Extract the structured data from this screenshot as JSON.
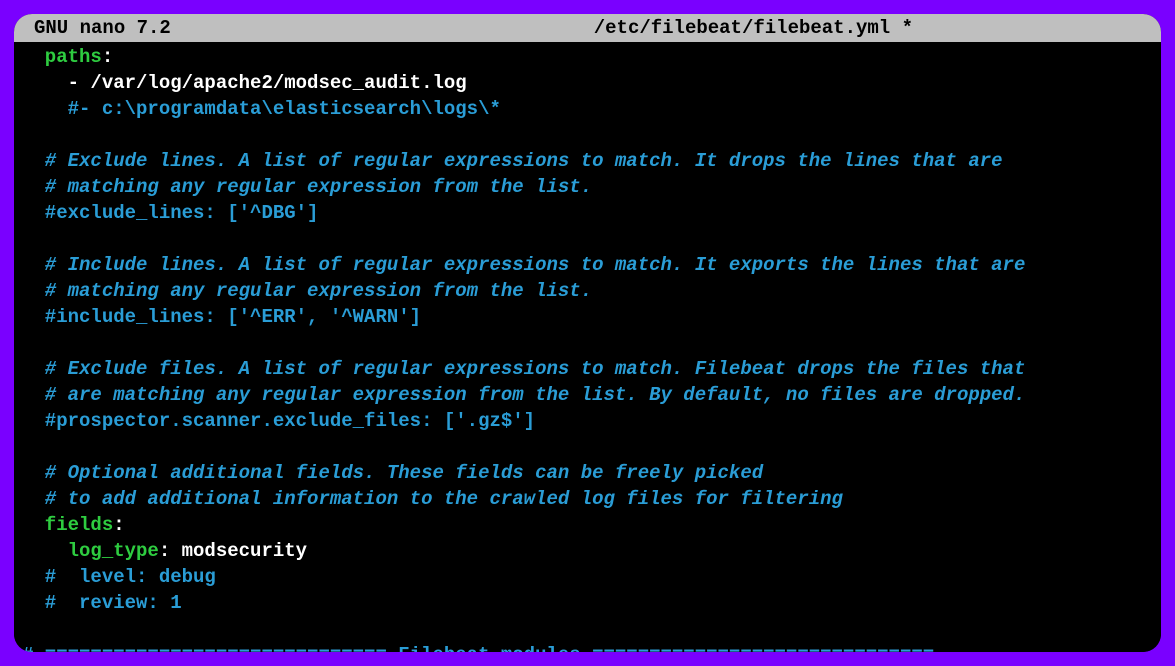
{
  "titlebar": {
    "app": "GNU nano 7.2",
    "file": "/etc/filebeat/filebeat.yml *"
  },
  "lines": {
    "l01a": "  paths",
    "l01b": ":",
    "l02": "    - /var/log/apache2/modsec_audit.log",
    "l03": "    #- c:\\programdata\\elasticsearch\\logs\\*",
    "l04": "",
    "l05": "  # Exclude lines. A list of regular expressions to match. It drops the lines that are",
    "l06": "  # matching any regular expression from the list.",
    "l07": "  #exclude_lines: ['^DBG']",
    "l08": "",
    "l09": "  # Include lines. A list of regular expressions to match. It exports the lines that are",
    "l10": "  # matching any regular expression from the list.",
    "l11": "  #include_lines: ['^ERR', '^WARN']",
    "l12": "",
    "l13": "  # Exclude files. A list of regular expressions to match. Filebeat drops the files that",
    "l14": "  # are matching any regular expression from the list. By default, no files are dropped.",
    "l15": "  #prospector.scanner.exclude_files: ['.gz$']",
    "l16": "",
    "l17": "  # Optional additional fields. These fields can be freely picked",
    "l18": "  # to add additional information to the crawled log files for filtering",
    "l19a": "  fields",
    "l19b": ":",
    "l20a": "    log_type",
    "l20b": ": modsecurity",
    "l21": "  #  level: debug",
    "l22": "  #  review: 1",
    "l23": "",
    "l24": "# ============================== Filebeat modules =============================="
  }
}
